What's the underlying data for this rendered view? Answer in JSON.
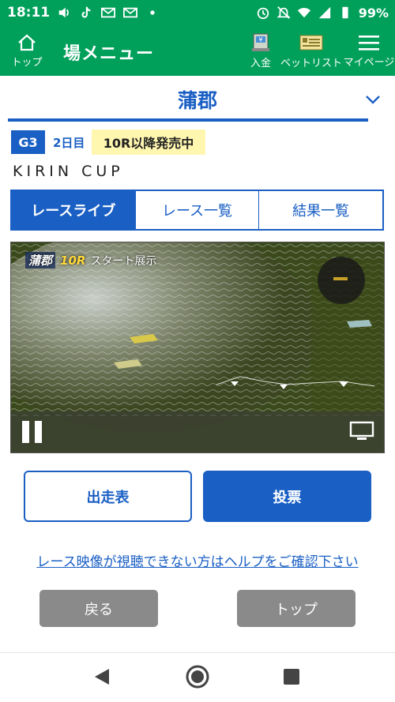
{
  "status_bar": {
    "time": "18:11",
    "battery": "99%",
    "icons_left": [
      "volume-icon",
      "tiktok-icon",
      "mail-icon",
      "mail-icon",
      "dot-icon"
    ],
    "icons_right": [
      "alarm-icon",
      "mute-icon",
      "wifi-icon",
      "signal-icon",
      "battery-icon"
    ]
  },
  "header": {
    "home_label": "トップ",
    "title": "場メニュー",
    "deposit_label": "入金",
    "betlist_label": "ベットリスト",
    "mypage_label": "マイページ"
  },
  "venue": {
    "name": "蒲郡"
  },
  "race_info": {
    "grade": "G3",
    "day": "2日目",
    "sale_status": "10R以降発売中",
    "title": "KIRIN CUP"
  },
  "tabs": [
    {
      "label": "レースライブ",
      "active": true
    },
    {
      "label": "レース一覧",
      "active": false
    },
    {
      "label": "結果一覧",
      "active": false
    }
  ],
  "video": {
    "venue": "蒲郡",
    "race": "10R",
    "label": "スタート展示"
  },
  "actions": {
    "entry_label": "出走表",
    "vote_label": "投票"
  },
  "help_link": "レース映像が視聴できない方はヘルプをご確認下さい",
  "footer": {
    "back_label": "戻る",
    "top_label": "トップ"
  },
  "colors": {
    "header_green": "#00a05a",
    "primary_blue": "#1a5fc4",
    "sale_yellow": "#fff6b0",
    "gray_button": "#8a8a8a"
  }
}
